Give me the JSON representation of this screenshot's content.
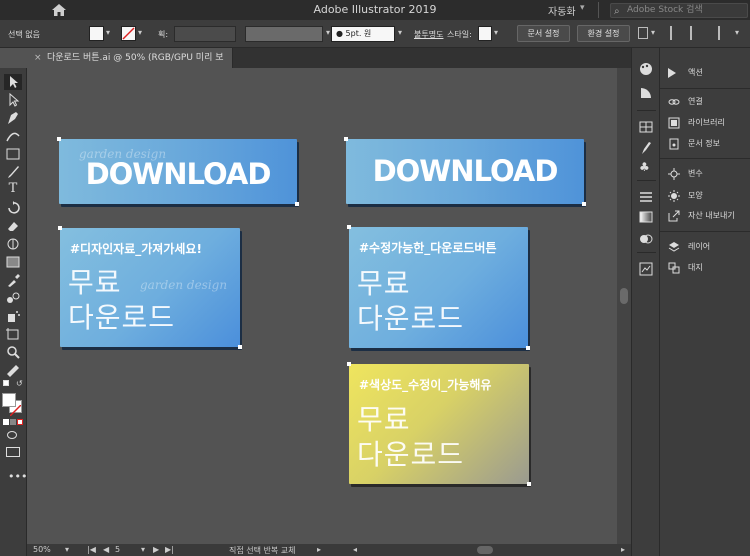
{
  "window": {
    "title": "Adobe Illustrator 2019",
    "workspace": "자동화",
    "stock_search_placeholder": "Adobe Stock 검색"
  },
  "control_bar": {
    "selection_label": "선택 없음",
    "stroke_label": "획:",
    "brush_label": "5pt. 원",
    "opacity_label": "불투명도",
    "style_label": "스타일:",
    "doc_setup_button": "문서 설정",
    "prefs_button": "환경 설정"
  },
  "document_tab": {
    "label": "다운로드 버튼.ai @ 50% (RGB/GPU 미리 보기)",
    "close": "×"
  },
  "artboard": {
    "download_buttons": [
      {
        "word": "DOWNLOAD",
        "watermark": "garden design"
      },
      {
        "word": "DOWNLOAD",
        "watermark": ""
      }
    ],
    "cards": [
      {
        "tag": "#디자인자료_가져가세요!",
        "line1": "무료",
        "line2": "다운로드",
        "watermark": "garden design",
        "style": "blue"
      },
      {
        "tag": "#수정가능한_다운로드버튼",
        "line1": "무료",
        "line2": "다운로드",
        "watermark": "",
        "style": "blue"
      },
      {
        "tag": "#색상도_수정이_가능해유",
        "line1": "무료",
        "line2": "다운로드",
        "watermark": "",
        "style": "yellow"
      }
    ]
  },
  "status_bar": {
    "zoom": "50%",
    "artboard_number": "5",
    "tool_name": "직접 선택 반복 교체"
  },
  "right_panel": {
    "items": [
      {
        "label": "액션",
        "icon": "play-icon"
      },
      {
        "label": "연결",
        "icon": "link-icon"
      },
      {
        "label": "라이브러리",
        "icon": "library-icon"
      },
      {
        "label": "문서 정보",
        "icon": "info-icon"
      },
      {
        "label": "변수",
        "icon": "variables-icon"
      },
      {
        "label": "모양",
        "icon": "appearance-icon"
      },
      {
        "label": "자산 내보내기",
        "icon": "export-icon"
      },
      {
        "label": "레이어",
        "icon": "layers-icon"
      },
      {
        "label": "대지",
        "icon": "artboards-icon"
      }
    ]
  },
  "colors": {
    "ui_dark": "#3d3d3d",
    "canvas": "#535353",
    "button_blue": "#5a9fdb",
    "card_yellow": "#e8df5c"
  }
}
